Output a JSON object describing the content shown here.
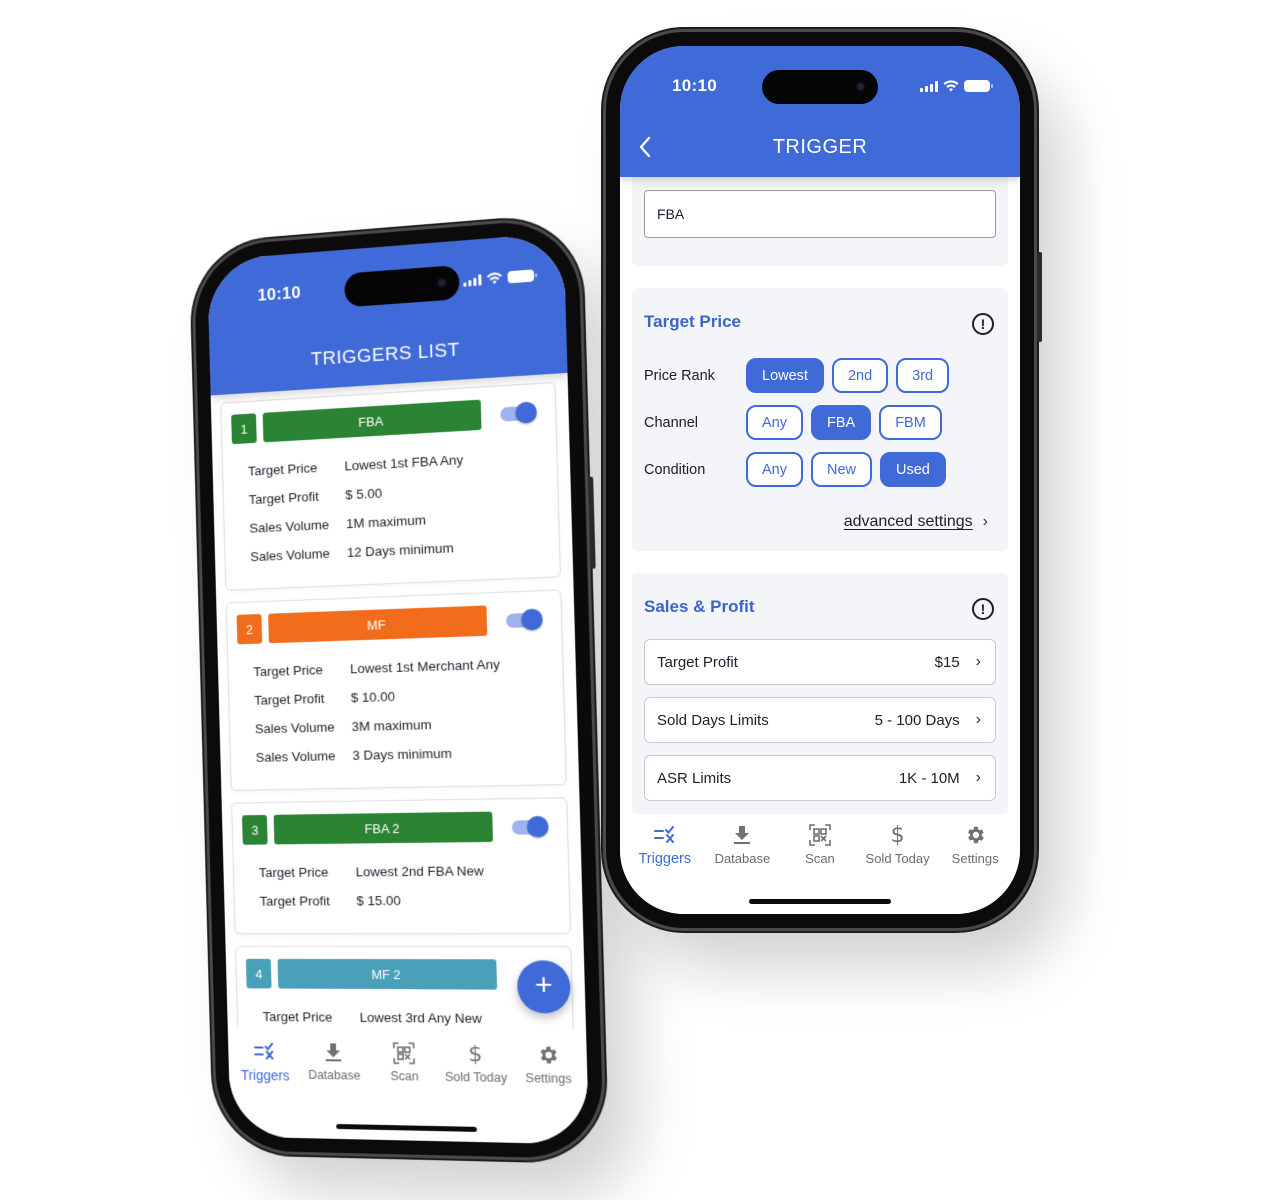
{
  "colors": {
    "primary": "#3f6ad8",
    "section_title": "#3b65c6",
    "fba_green": "#2a8434",
    "mf_orange": "#f26d1b",
    "mf2_teal": "#4aa0b8"
  },
  "status_bar": {
    "time": "10:10"
  },
  "trigger_screen": {
    "title": "TRIGGER",
    "back_icon": "chevron-left-icon",
    "name_input": {
      "value": "FBA"
    },
    "target_price": {
      "title": "Target Price",
      "info_icon": "info-icon",
      "rows": [
        {
          "label": "Price Rank",
          "options": [
            "Lowest",
            "2nd",
            "3rd"
          ],
          "selected": "Lowest"
        },
        {
          "label": "Channel",
          "options": [
            "Any",
            "FBA",
            "FBM"
          ],
          "selected": "FBA"
        },
        {
          "label": "Condition",
          "options": [
            "Any",
            "New",
            "Used"
          ],
          "selected": "Used"
        }
      ],
      "advanced_link": "advanced settings"
    },
    "sales_profit": {
      "title": "Sales & Profit",
      "info_icon": "info-icon",
      "rows": [
        {
          "label": "Target Profit",
          "value": "$15"
        },
        {
          "label": "Sold Days Limits",
          "value": "5 - 100 Days"
        },
        {
          "label": "ASR Limits",
          "value": "1K - 10M"
        }
      ]
    }
  },
  "triggers_list": {
    "title": "TRIGGERS LIST",
    "fab_label": "+",
    "items": [
      {
        "number": "1",
        "name": "FBA",
        "color": "#2a8434",
        "enabled": true,
        "rows": [
          {
            "key": "Target Price",
            "value": "Lowest 1st FBA Any"
          },
          {
            "key": "Target Profit",
            "value": "$ 5.00"
          },
          {
            "key": "Sales Volume",
            "value": "1M maximum"
          },
          {
            "key": "Sales Volume",
            "value": "12 Days minimum"
          }
        ]
      },
      {
        "number": "2",
        "name": "MF",
        "color": "#f26d1b",
        "enabled": true,
        "rows": [
          {
            "key": "Target Price",
            "value": "Lowest 1st Merchant Any"
          },
          {
            "key": "Target Profit",
            "value": "$ 10.00"
          },
          {
            "key": "Sales Volume",
            "value": "3M maximum"
          },
          {
            "key": "Sales Volume",
            "value": "3 Days minimum"
          }
        ]
      },
      {
        "number": "3",
        "name": "FBA 2",
        "color": "#2a8434",
        "enabled": true,
        "rows": [
          {
            "key": "Target Price",
            "value": "Lowest 2nd FBA New"
          },
          {
            "key": "Target Profit",
            "value": "$ 15.00"
          }
        ]
      },
      {
        "number": "4",
        "name": "MF 2",
        "color": "#4aa0b8",
        "enabled": null,
        "rows": [
          {
            "key": "Target Price",
            "value": "Lowest 3rd Any New"
          }
        ]
      }
    ]
  },
  "tab_bar": {
    "items": [
      {
        "label": "Triggers",
        "icon": "triggers-icon",
        "active": true
      },
      {
        "label": "Database",
        "icon": "download-icon",
        "active": false
      },
      {
        "label": "Scan",
        "icon": "qr-scan-icon",
        "active": false
      },
      {
        "label": "Sold Today",
        "icon": "dollar-icon",
        "active": false
      },
      {
        "label": "Settings",
        "icon": "gear-icon",
        "active": false
      }
    ]
  }
}
